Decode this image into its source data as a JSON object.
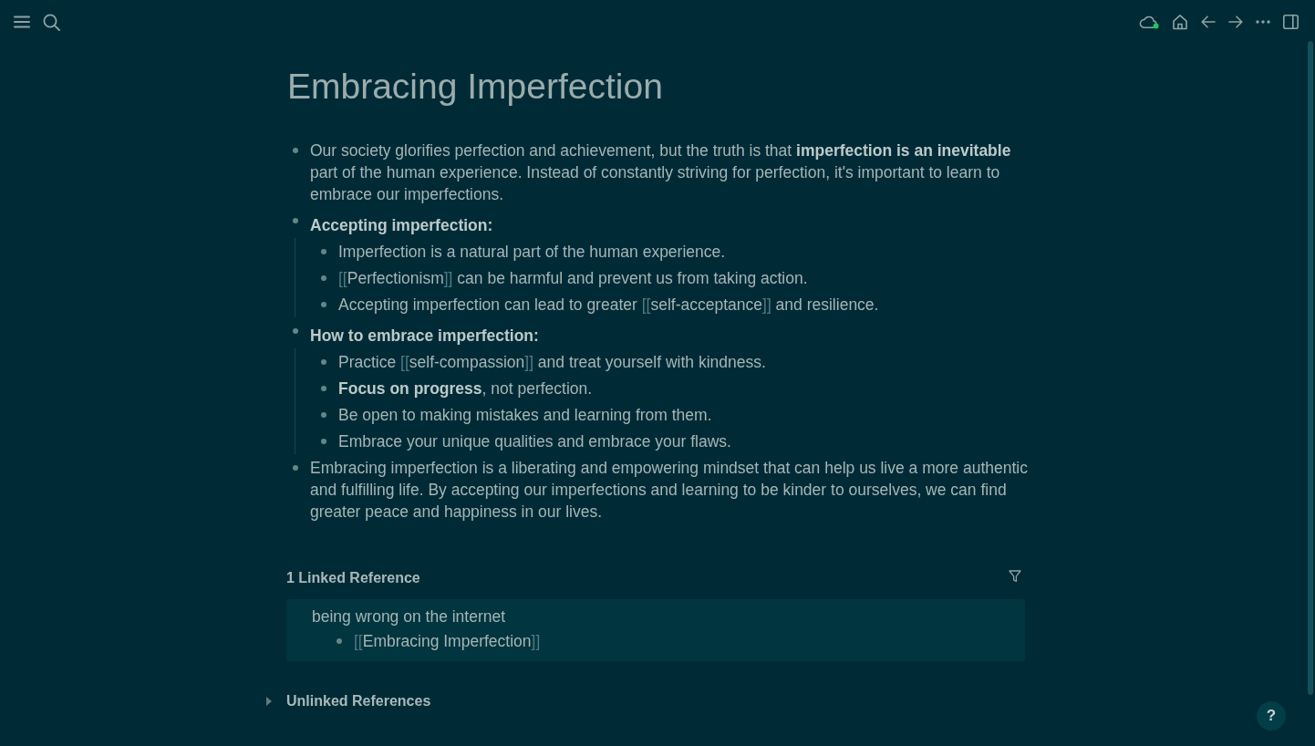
{
  "page": {
    "title": "Embracing Imperfection",
    "blocks": [
      {
        "bold": false,
        "segments": [
          {
            "kind": "text",
            "text": "Our society glorifies perfection and achievement, but the truth is that **imperfection is an inevitable** part of the human experience. Instead of constantly striving for perfection, it's important to learn to embrace our imperfections."
          }
        ]
      },
      {
        "bold": true,
        "segments": [
          {
            "kind": "text",
            "text": "Accepting imperfection:"
          }
        ],
        "children": [
          {
            "bold": false,
            "segments": [
              {
                "kind": "text",
                "text": "Imperfection is a natural part of the human experience."
              }
            ]
          },
          {
            "bold": false,
            "segments": [
              {
                "kind": "ref",
                "open": "[[",
                "text": "Perfectionism",
                "close": "]]"
              },
              {
                "kind": "text",
                "text": " can be harmful and prevent us from taking action."
              }
            ]
          },
          {
            "bold": false,
            "segments": [
              {
                "kind": "text",
                "text": "Accepting imperfection can lead to greater "
              },
              {
                "kind": "ref",
                "open": "[[",
                "text": "self-acceptance",
                "close": "]]"
              },
              {
                "kind": "text",
                "text": " and resilience."
              }
            ]
          }
        ]
      },
      {
        "bold": true,
        "segments": [
          {
            "kind": "text",
            "text": "How to embrace imperfection:"
          }
        ],
        "children": [
          {
            "bold": false,
            "segments": [
              {
                "kind": "text",
                "text": "Practice "
              },
              {
                "kind": "ref",
                "open": "[[",
                "text": "self-compassion",
                "close": "]]"
              },
              {
                "kind": "text",
                "text": " and treat yourself with kindness."
              }
            ]
          },
          {
            "bold": false,
            "segments": [
              {
                "kind": "text",
                "text": "**Focus on progress**, not perfection."
              }
            ]
          },
          {
            "bold": false,
            "segments": [
              {
                "kind": "text",
                "text": "Be open to making mistakes and learning from them."
              }
            ]
          },
          {
            "bold": false,
            "segments": [
              {
                "kind": "text",
                "text": "Embrace your unique qualities and embrace your flaws."
              }
            ]
          }
        ]
      },
      {
        "bold": false,
        "segments": [
          {
            "kind": "text",
            "text": "Embracing imperfection is a liberating and empowering mindset that can help us live a more authentic and fulfilling life. By accepting our imperfections and learning to be kinder to ourselves, we can find greater peace and happiness in our lives."
          }
        ]
      }
    ]
  },
  "linked_references": {
    "title": "1 Linked Reference",
    "groups": [
      {
        "page": "being wrong on the internet",
        "blocks": [
          {
            "bold": false,
            "segments": [
              {
                "kind": "ref",
                "open": "[[",
                "text": "Embracing Imperfection",
                "close": "]]"
              }
            ]
          }
        ]
      }
    ]
  },
  "unlinked_references": {
    "title": "Unlinked References",
    "expanded": false
  },
  "help_button": {
    "label": "?"
  }
}
